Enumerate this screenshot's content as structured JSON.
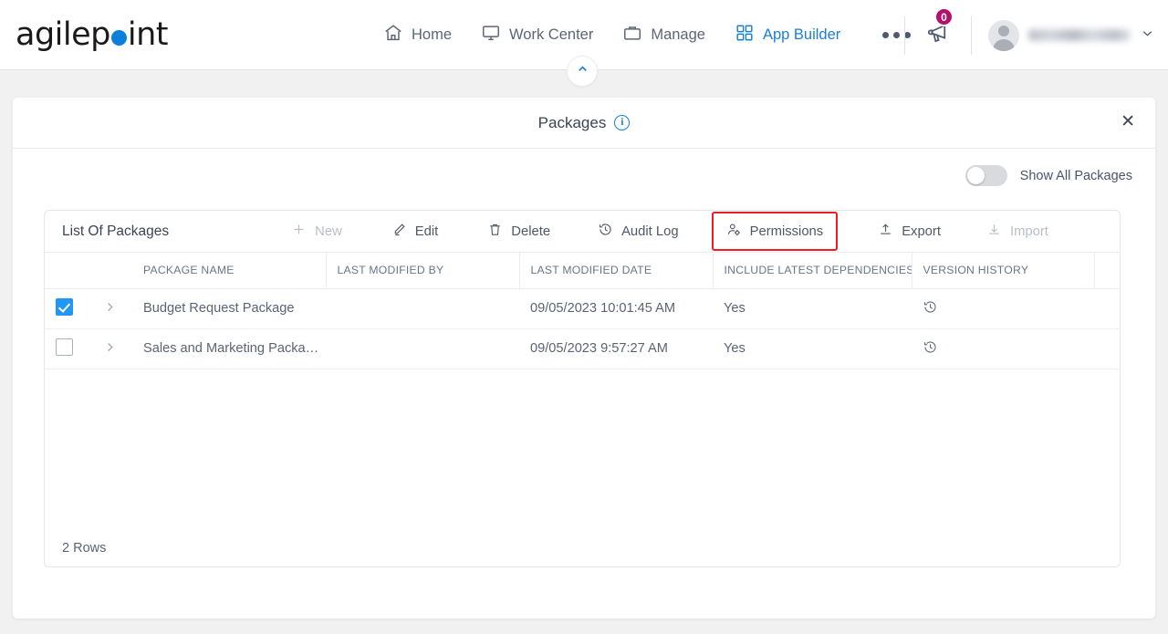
{
  "brand": {
    "name_part1": "agilep",
    "name_part2": "int",
    "accent": "#0b80d8"
  },
  "nav": {
    "items": [
      {
        "label": "Home",
        "icon": "home-icon",
        "active": false
      },
      {
        "label": "Work Center",
        "icon": "monitor-icon",
        "active": false
      },
      {
        "label": "Manage",
        "icon": "briefcase-icon",
        "active": false
      },
      {
        "label": "App Builder",
        "icon": "grid-icon",
        "active": true
      }
    ],
    "overflow_label": "more-options"
  },
  "topright": {
    "announcement_icon": "megaphone-icon",
    "announcement_count": "0",
    "badge_color": "#b4116e",
    "user_name": "",
    "chevron": "⌄"
  },
  "collapse": {
    "icon": "chevron-up-icon"
  },
  "panel": {
    "title": "Packages",
    "info_icon": "info-icon",
    "close_icon": "close-icon",
    "toggle": {
      "label": "Show All Packages",
      "state": "off"
    }
  },
  "grid": {
    "title": "List Of Packages",
    "toolbar": [
      {
        "label": "New",
        "icon": "plus-icon",
        "disabled": true,
        "highlighted": false
      },
      {
        "label": "Edit",
        "icon": "pencil-icon",
        "disabled": false,
        "highlighted": false
      },
      {
        "label": "Delete",
        "icon": "trash-icon",
        "disabled": false,
        "highlighted": false
      },
      {
        "label": "Audit Log",
        "icon": "history-icon",
        "disabled": false,
        "highlighted": false
      },
      {
        "label": "Permissions",
        "icon": "user-gear-icon",
        "disabled": false,
        "highlighted": true
      },
      {
        "label": "Export",
        "icon": "upload-icon",
        "disabled": false,
        "highlighted": false
      },
      {
        "label": "Import",
        "icon": "download-icon",
        "disabled": true,
        "highlighted": false
      }
    ],
    "highlight_color": "#ee1c25",
    "columns": [
      "PACKAGE NAME",
      "LAST MODIFIED BY",
      "LAST MODIFIED DATE",
      "INCLUDE LATEST DEPENDENCIES",
      "VERSION HISTORY"
    ],
    "rows": [
      {
        "selected": true,
        "package_name": "Budget Request Package",
        "last_modified_by": "",
        "last_modified_date": "09/05/2023 10:01:45 AM",
        "include_latest_dependencies": "Yes",
        "version_history_icon": "history-icon"
      },
      {
        "selected": false,
        "package_name": "Sales and Marketing Packa…",
        "last_modified_by": "",
        "last_modified_date": "09/05/2023 9:57:27 AM",
        "include_latest_dependencies": "Yes",
        "version_history_icon": "history-icon"
      }
    ],
    "row_count_label": "2 Rows"
  }
}
